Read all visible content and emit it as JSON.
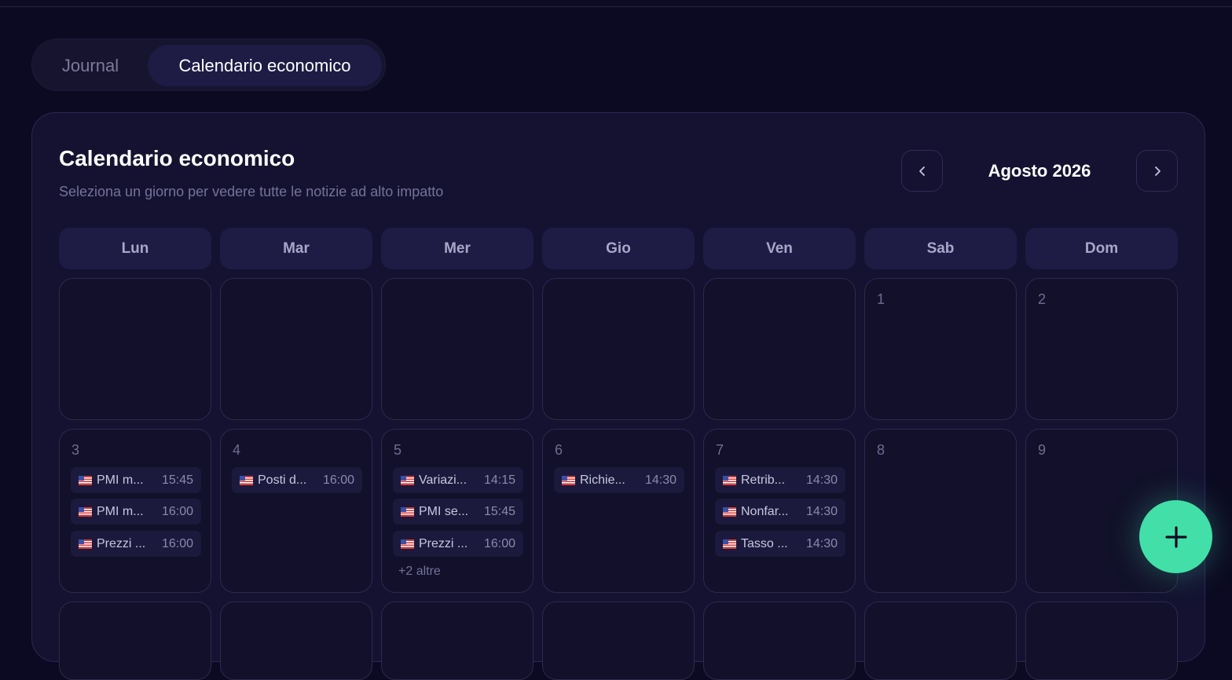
{
  "tabs": [
    {
      "label": "Journal",
      "active": false
    },
    {
      "label": "Calendario economico",
      "active": true
    }
  ],
  "card": {
    "title": "Calendario economico",
    "subtitle": "Seleziona un giorno per vedere tutte le notizie ad alto impatto"
  },
  "month": {
    "label": "Agosto 2026"
  },
  "weekdays": [
    "Lun",
    "Mar",
    "Mer",
    "Gio",
    "Ven",
    "Sab",
    "Dom"
  ],
  "days": {
    "d1": "1",
    "d2": "2",
    "d3": "3",
    "d4": "4",
    "d5": "5",
    "d6": "6",
    "d7": "7",
    "d8": "8",
    "d9": "9"
  },
  "events": {
    "d3": [
      {
        "name": "PMI m...",
        "time": "15:45"
      },
      {
        "name": "PMI m...",
        "time": "16:00"
      },
      {
        "name": "Prezzi ...",
        "time": "16:00"
      }
    ],
    "d4": [
      {
        "name": "Posti d...",
        "time": "16:00"
      }
    ],
    "d5": [
      {
        "name": "Variazi...",
        "time": "14:15"
      },
      {
        "name": "PMI se...",
        "time": "15:45"
      },
      {
        "name": "Prezzi ...",
        "time": "16:00"
      }
    ],
    "d5_more": "+2 altre",
    "d6": [
      {
        "name": "Richie...",
        "time": "14:30"
      }
    ],
    "d7": [
      {
        "name": "Retrib...",
        "time": "14:30"
      },
      {
        "name": "Nonfar...",
        "time": "14:30"
      },
      {
        "name": "Tasso ...",
        "time": "14:30"
      }
    ]
  },
  "icons": {
    "prev": "chevron-left-icon",
    "next": "chevron-right-icon",
    "flag": "us-flag-icon",
    "fab": "plus-icon"
  },
  "colors": {
    "background": "#0c0a22",
    "card": "#141230",
    "accent": "#42e0a8",
    "active_tab": "#1e1c45"
  }
}
